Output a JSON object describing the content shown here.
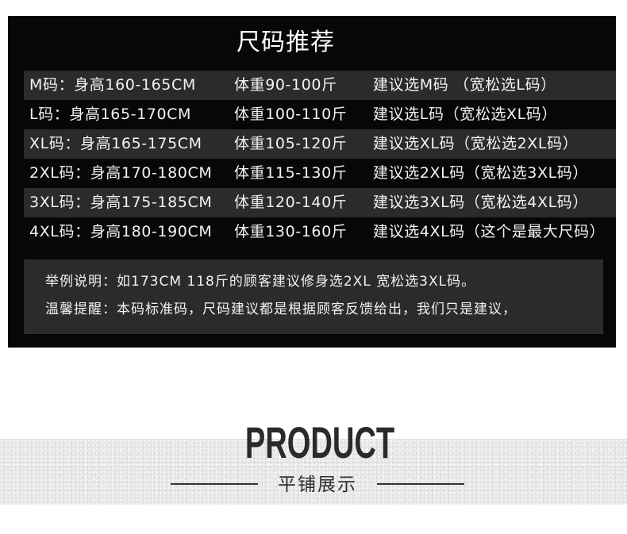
{
  "theme": {
    "panel_bg": "#070707",
    "stripe_bg": "#2b2b2b",
    "text": "#f2f2f2",
    "heading": "#2a2a2a"
  },
  "size_chart": {
    "title": "尺码推荐",
    "rows": [
      {
        "size_height": "M码：身高160-165CM",
        "weight": "体重90-100斤",
        "suggestion": "建议选M码 （宽松选L码）"
      },
      {
        "size_height": "L码：身高165-170CM",
        "weight": "体重100-110斤",
        "suggestion": "建议选L码（宽松选XL码）"
      },
      {
        "size_height": "XL码：身高165-175CM",
        "weight": "体重105-120斤",
        "suggestion": "建议选XL码（宽松选2XL码）"
      },
      {
        "size_height": "2XL码：身高170-180CM",
        "weight": "体重115-130斤",
        "suggestion": "建议选2XL码（宽松选3XL码）"
      },
      {
        "size_height": "3XL码：身高175-185CM",
        "weight": "体重120-140斤",
        "suggestion": "建议选3XL码（宽松选4XL码）"
      },
      {
        "size_height": "4XL码：身高180-190CM",
        "weight": "体重130-160斤",
        "suggestion": "建议选4XL码（这个是最大尺码）"
      }
    ]
  },
  "notes": {
    "example": "举例说明：如173CM 118斤的顾客建议修身选2XL 宽松选3XL码。",
    "reminder": "温馨提醒：本码标准码，尺码建议都是根据顾客反馈给出，我们只是建议，"
  },
  "product_section": {
    "heading": "PRODUCT",
    "subheading": "平铺展示"
  }
}
